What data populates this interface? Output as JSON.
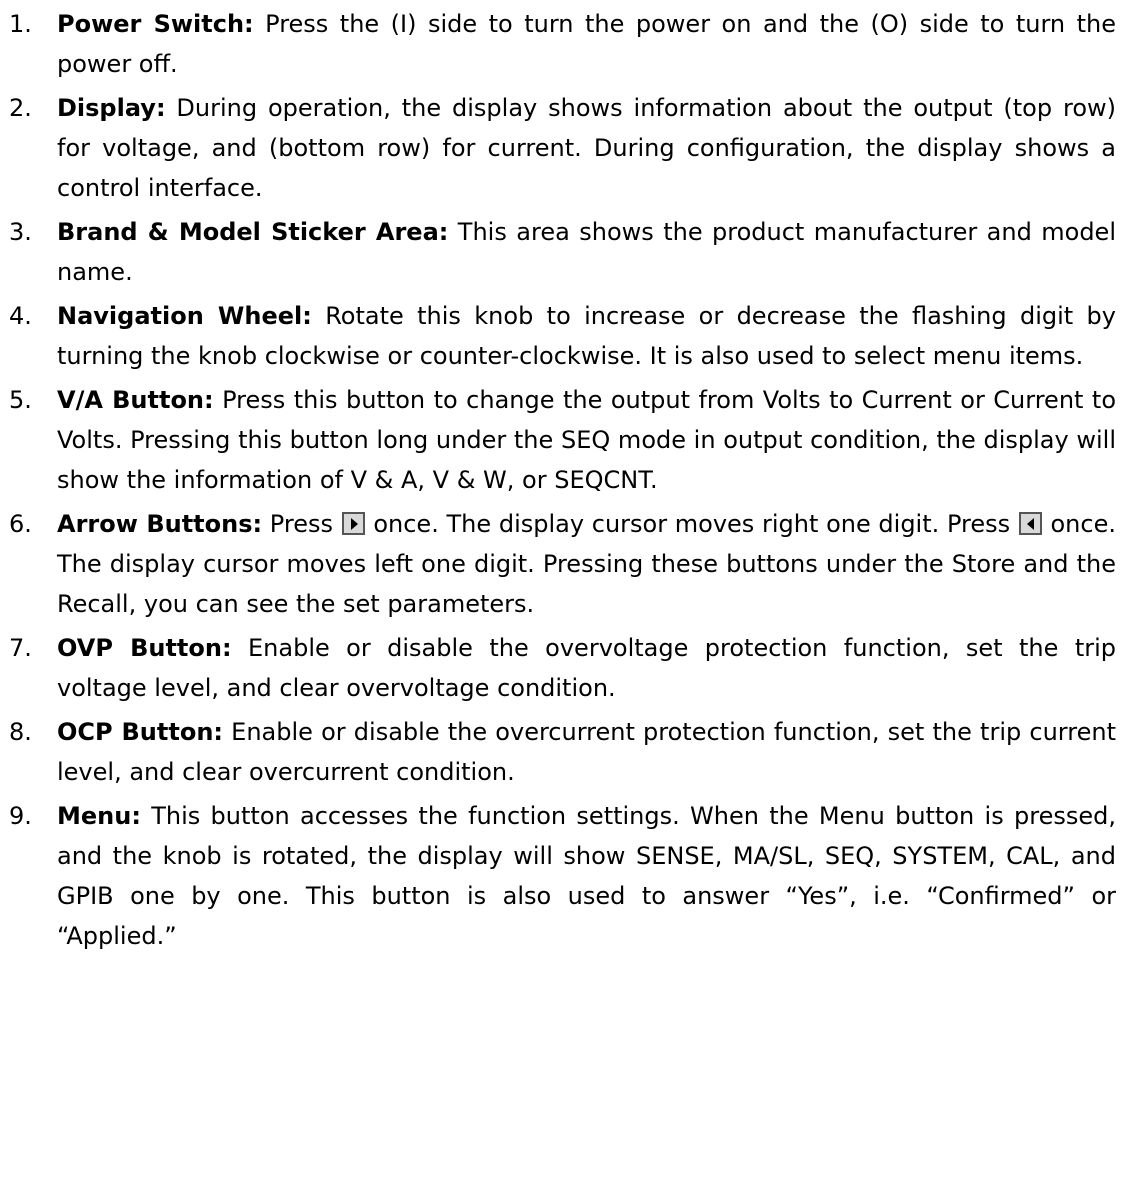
{
  "items": [
    {
      "number": "1.",
      "term": "Power Switch:",
      "text": " Press the (I) side to turn the power on and the (O) side to turn the power off."
    },
    {
      "number": "2.",
      "term": "Display:",
      "text": " During operation, the display shows information about the output (top row) for voltage, and (bottom row) for current. During configuration, the display shows a control interface."
    },
    {
      "number": "3.",
      "term": "Brand & Model Sticker Area:",
      "text": " This area shows the product manufacturer and model name."
    },
    {
      "number": "4.",
      "term": "Navigation Wheel:",
      "text": " Rotate this knob to increase or decrease the flashing digit by turning the knob clockwise or counter-clockwise. It is also used to select menu items."
    },
    {
      "number": "5.",
      "term": "V/A Button:",
      "text": " Press this button to change the output from Volts to Current or Current to Volts. Pressing this button long under the SEQ mode in output condition, the display will show the information of V & A, V & W, or SEQCNT."
    },
    {
      "number": "6.",
      "term": "Arrow Buttons:",
      "text_a": " Press ",
      "text_b": " once. The display cursor moves right one digit. Press ",
      "text_c": " once. The display cursor moves left one digit. Pressing these buttons under the Store and the Recall, you can see the set parameters.",
      "right_icon": "right-arrow-key-icon",
      "left_icon": "left-arrow-key-icon"
    },
    {
      "number": "7.",
      "term": "OVP Button:",
      "text": " Enable or disable the overvoltage protection function, set the trip voltage level, and clear overvoltage condition."
    },
    {
      "number": "8.",
      "term": "OCP Button:",
      "text": " Enable or disable the overcurrent protection function, set the trip current level, and clear overcurrent condition."
    },
    {
      "number": "9.",
      "term": "Menu:",
      "text": " This button accesses the function settings. When the Menu button is pressed, and the knob is rotated,   the display will show SENSE, MA/SL, SEQ, SYSTEM, CAL, and GPIB one by one. This button is also used to answer “Yes”, i.e. “Confirmed” or “Applied.”"
    }
  ]
}
